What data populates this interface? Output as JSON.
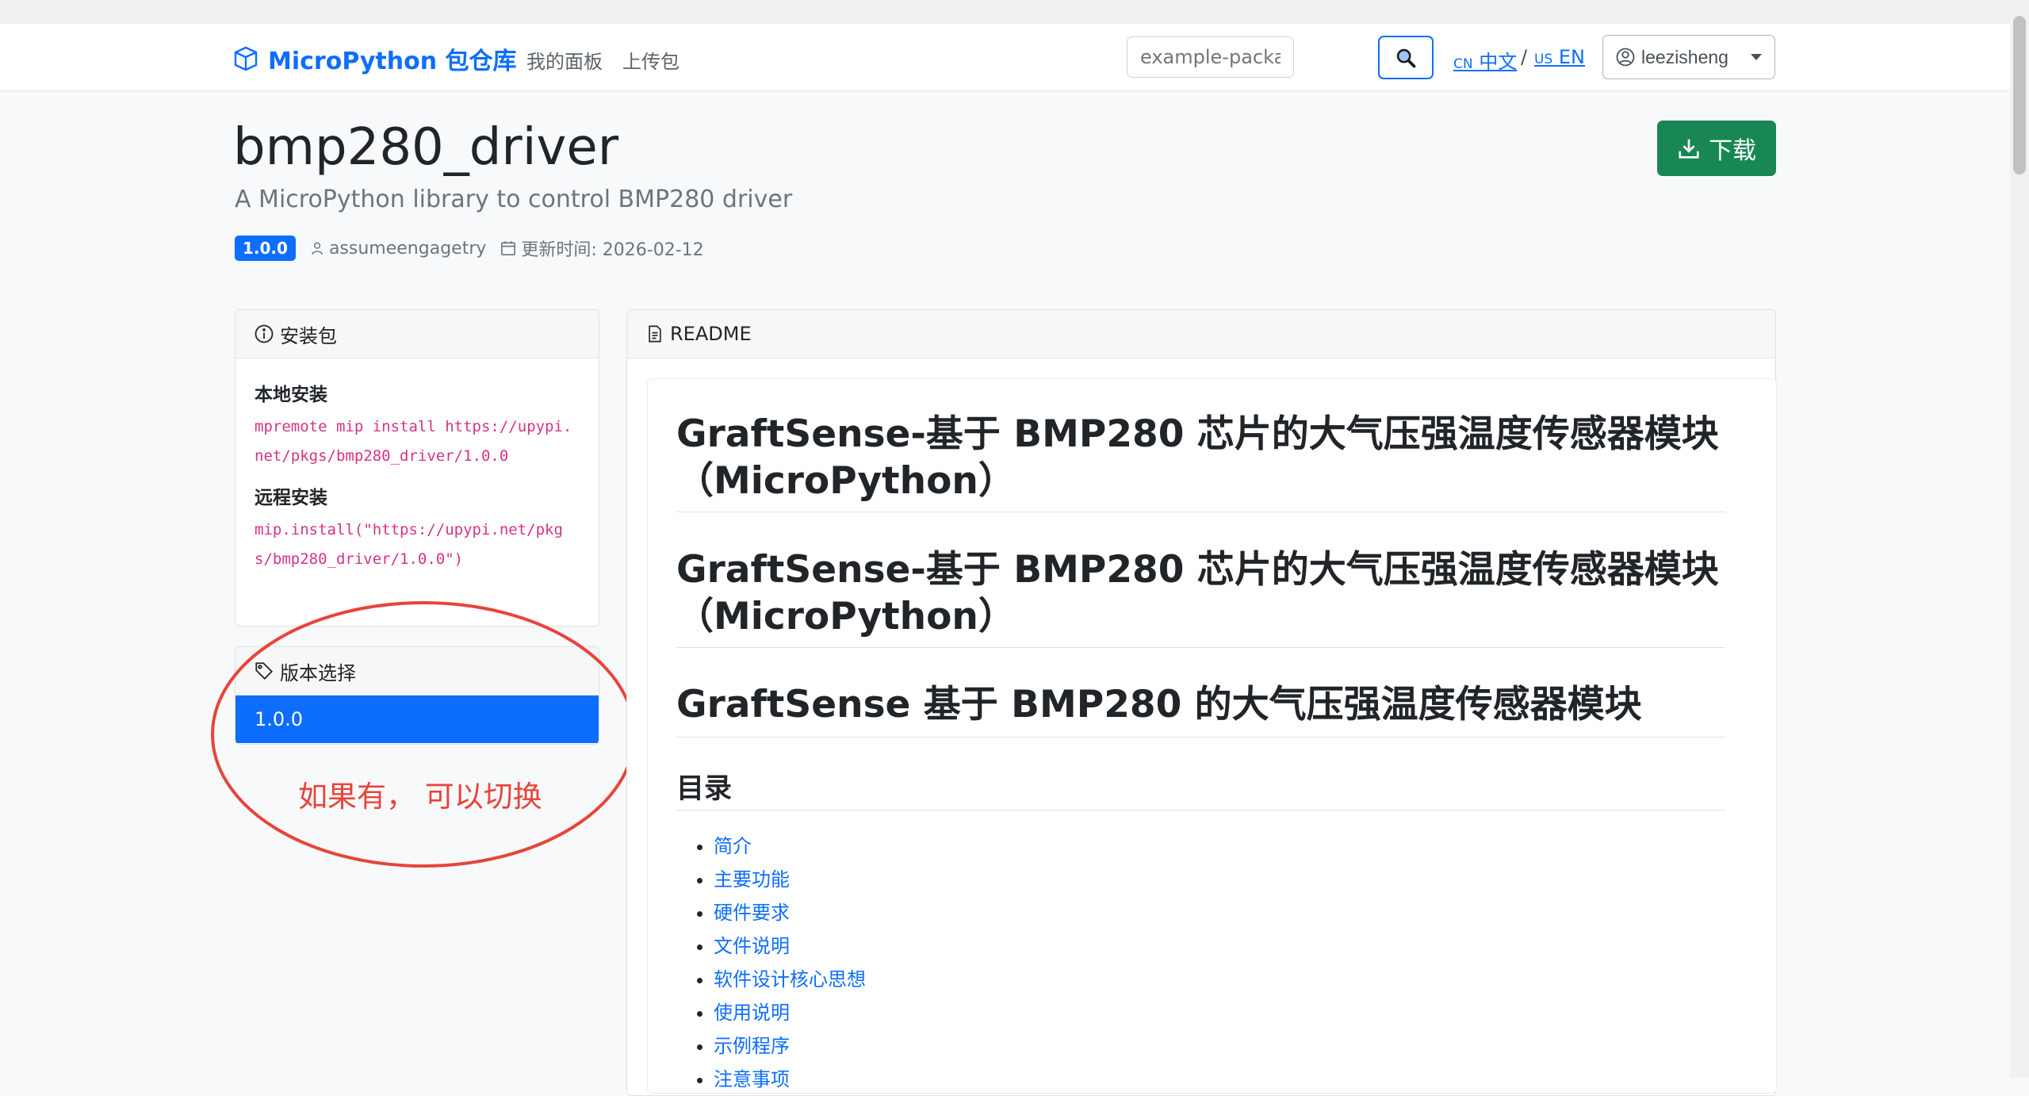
{
  "navbar": {
    "brand": "MicroPython 包仓库",
    "links": [
      "我的面板",
      "上传包"
    ],
    "search_placeholder": "example-package...",
    "lang_cn_flag": "CN",
    "lang_cn": "中文",
    "lang_sep": "/",
    "lang_en_flag": "US",
    "lang_en": "EN",
    "user": "leezisheng"
  },
  "package": {
    "name": "bmp280_driver",
    "description": "A MicroPython library to control BMP280 driver",
    "version_badge": "1.0.0",
    "author": "assumeengagetry",
    "updated": "更新时间: 2026-02-12",
    "download_label": "下载"
  },
  "install_card": {
    "title": "安装包",
    "local_label": "本地安装",
    "local_cmd": "mpremote mip install https://upypi.net/pkgs/bmp280_driver/1.0.0",
    "remote_label": "远程安装",
    "remote_cmd": "mip.install(\"https://upypi.net/pkgs/bmp280_driver/1.0.0\")"
  },
  "version_card": {
    "title": "版本选择",
    "versions": [
      "1.0.0"
    ]
  },
  "annotation": {
    "text": "如果有， 可以切换",
    "color": "#e8443a"
  },
  "readme": {
    "title": "README",
    "headings": [
      "GraftSense-基于 BMP280 芯片的大气压强温度传感器模块（MicroPython）",
      "GraftSense-基于 BMP280 芯片的大气压强温度传感器模块（MicroPython）",
      "GraftSense 基于 BMP280 的大气压强温度传感器模块"
    ],
    "toc_title": "目录",
    "toc": [
      "简介",
      "主要功能",
      "硬件要求",
      "文件说明",
      "软件设计核心思想",
      "使用说明",
      "示例程序",
      "注意事项"
    ]
  },
  "colors": {
    "primary": "#0d6efd",
    "success": "#198754",
    "code": "#d63384"
  }
}
